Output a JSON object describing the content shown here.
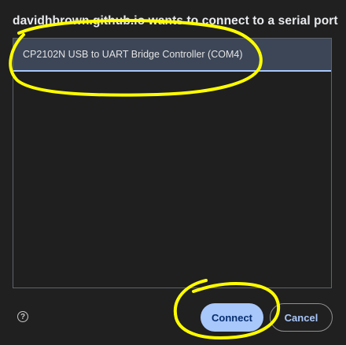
{
  "dialog": {
    "title": "davidhbrown.github.io wants to connect to a serial port"
  },
  "ports": [
    {
      "label": "CP2102N USB to UART Bridge Controller (COM4)",
      "selected": true
    }
  ],
  "footer": {
    "help_glyph": "?",
    "help_icon": "help-circle-icon",
    "connect_label": "Connect",
    "cancel_label": "Cancel"
  },
  "colors": {
    "accent": "#a8c7fa",
    "selected_row": "#3c4657",
    "annotation": "#ffff00"
  }
}
